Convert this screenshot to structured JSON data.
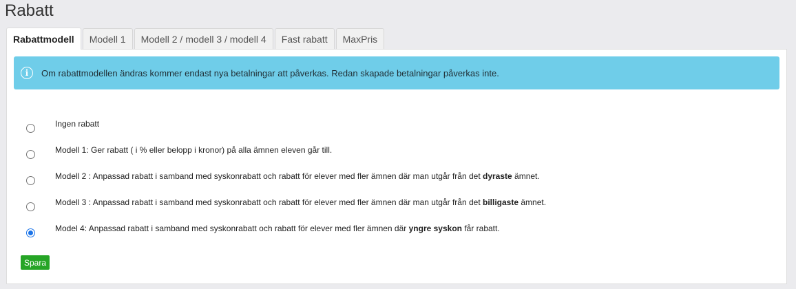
{
  "page": {
    "title": "Rabatt"
  },
  "tabs": [
    {
      "label": "Rabattmodell",
      "active": true
    },
    {
      "label": "Modell 1",
      "active": false
    },
    {
      "label": "Modell 2 / modell 3 / modell 4",
      "active": false
    },
    {
      "label": "Fast rabatt",
      "active": false
    },
    {
      "label": "MaxPris",
      "active": false
    }
  ],
  "alert": {
    "icon": "info-icon",
    "text": "Om rabattmodellen ändras kommer endast nya betalningar att påverkas. Redan skapade betalningar påverkas inte."
  },
  "options": [
    {
      "before": "Ingen rabatt",
      "bold": "",
      "after": "",
      "checked": false
    },
    {
      "before": "Modell 1: Ger rabatt ( i % eller belopp i kronor) på alla ämnen eleven går till.",
      "bold": "",
      "after": "",
      "checked": false
    },
    {
      "before": "Modell 2 : Anpassad rabatt i samband med syskonrabatt och rabatt för elever med fler ämnen där man utgår från det ",
      "bold": "dyraste",
      "after": " ämnet.",
      "checked": false
    },
    {
      "before": "Modell 3 : Anpassad rabatt i samband med syskonrabatt och rabatt för elever med fler ämnen där man utgår från det ",
      "bold": "billigaste",
      "after": " ämnet.",
      "checked": false
    },
    {
      "before": "Model 4: Anpassad rabatt i samband med syskonrabatt och rabatt för elever med fler ämnen där ",
      "bold": "yngre syskon",
      "after": " får rabatt.",
      "checked": true
    }
  ],
  "save_button": {
    "label": "Spara"
  },
  "colors": {
    "alert_bg": "#6fcde9",
    "save_bg": "#26a526",
    "radio_selected": "#1a73e8"
  }
}
